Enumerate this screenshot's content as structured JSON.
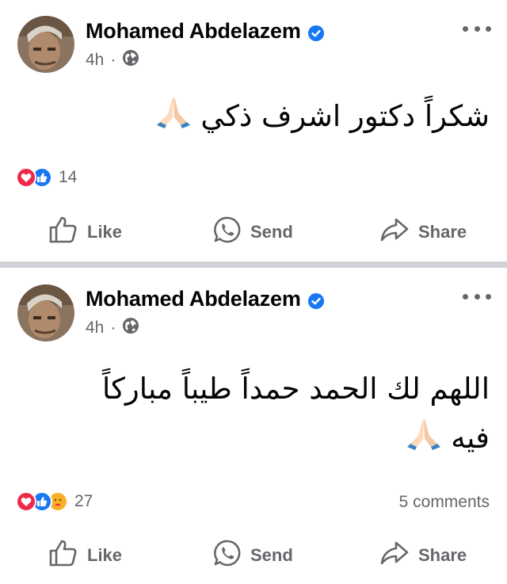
{
  "posts": [
    {
      "author": "Mohamed Abdelazem",
      "time": "4h",
      "privacy_icon": "globe-icon",
      "text": "شكراً دكتور اشرف ذكي",
      "text_lines": [
        "شكراً دكتور اشرف ذكي 🙏"
      ],
      "reactions": [
        "love",
        "like"
      ],
      "reaction_count": "14",
      "comments": "",
      "actions": {
        "like": "Like",
        "send": "Send",
        "share": "Share"
      }
    },
    {
      "author": "Mohamed Abdelazem",
      "time": "4h",
      "privacy_icon": "globe-icon",
      "text_line1": "اللهم لك الحمد حمداً طيباً مباركاً",
      "text_line2": "فيه",
      "reactions": [
        "love",
        "like",
        "care"
      ],
      "reaction_count": "27",
      "comments": "5 comments",
      "actions": {
        "like": "Like",
        "send": "Send",
        "share": "Share"
      }
    }
  ],
  "colors": {
    "text": "#050505",
    "secondary": "#65676b",
    "verified": "#1877f2",
    "love": "#f0284a",
    "like": "#1877f2",
    "care": "#f7b125",
    "divider": "#cfd2d6"
  }
}
